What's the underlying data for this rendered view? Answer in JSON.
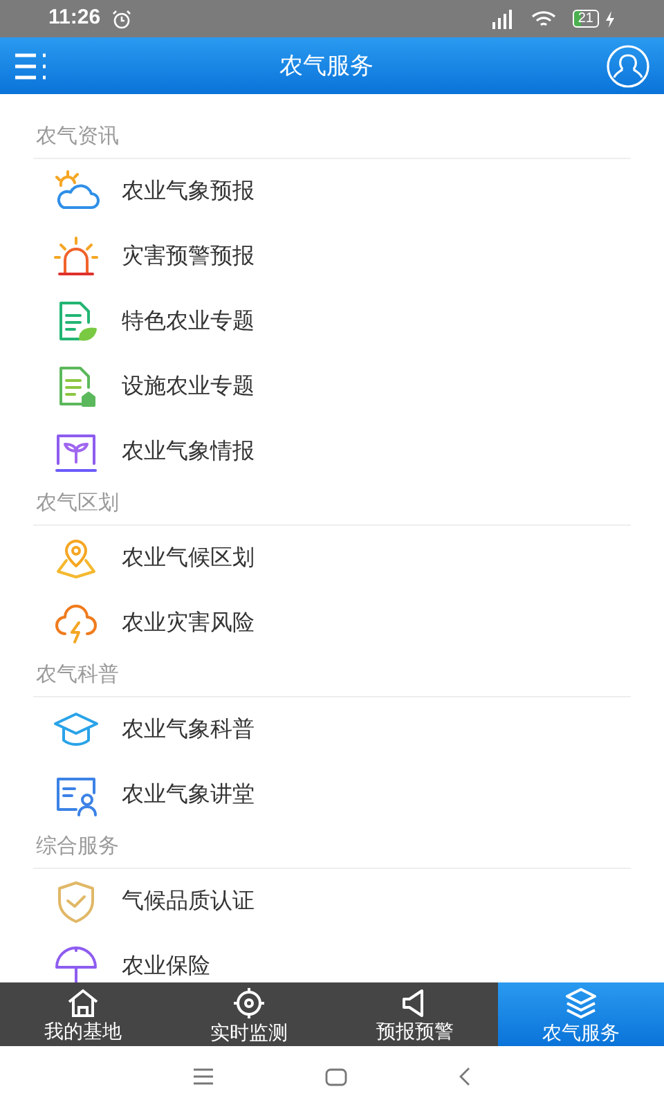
{
  "status_bar": {
    "time": "11:26",
    "battery": "21"
  },
  "header": {
    "title": "农气服务"
  },
  "sections": [
    {
      "title": "农气资讯",
      "items": [
        "农业气象预报",
        "灾害预警预报",
        "特色农业专题",
        "设施农业专题",
        "农业气象情报"
      ]
    },
    {
      "title": "农气区划",
      "items": [
        "农业气候区划",
        "农业灾害风险"
      ]
    },
    {
      "title": "农气科普",
      "items": [
        "农业气象科普",
        "农业气象讲堂"
      ]
    },
    {
      "title": "综合服务",
      "items": [
        "气候品质认证",
        "农业保险"
      ]
    }
  ],
  "tabs": [
    {
      "label": "我的基地",
      "selected": false
    },
    {
      "label": "实时监测",
      "selected": false
    },
    {
      "label": "预报预警",
      "selected": false
    },
    {
      "label": "农气服务",
      "selected": true
    }
  ]
}
